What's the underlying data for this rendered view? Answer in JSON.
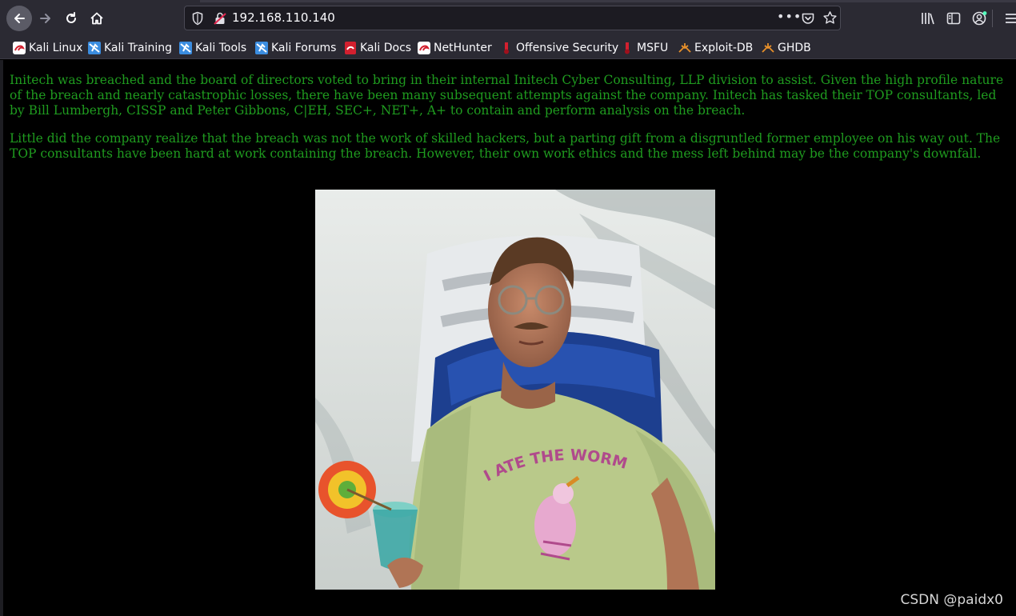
{
  "browser": {
    "url": "192.168.110.140"
  },
  "bookmarks": [
    {
      "label": "Kali Linux",
      "icon": "kali-dragon-icon"
    },
    {
      "label": "Kali Training",
      "icon": "kali-training-icon"
    },
    {
      "label": "Kali Tools",
      "icon": "kali-tools-icon"
    },
    {
      "label": "Kali Forums",
      "icon": "kali-forums-icon"
    },
    {
      "label": "Kali Docs",
      "icon": "kali-docs-icon"
    },
    {
      "label": "NetHunter",
      "icon": "nethunter-icon"
    },
    {
      "label": "Offensive Security",
      "icon": "offsec-icon"
    },
    {
      "label": "MSFU",
      "icon": "msfu-icon"
    },
    {
      "label": "Exploit-DB",
      "icon": "exploit-db-icon"
    },
    {
      "label": "GHDB",
      "icon": "ghdb-icon"
    }
  ],
  "page": {
    "paragraphs": [
      "Initech was breached and the board of directors voted to bring in their internal Initech Cyber Consulting, LLP division to assist. Given the high profile nature of the breach and nearly catastrophic losses, there have been many subsequent attempts against the company. Initech has tasked their TOP consultants, led by Bill Lumbergh, CISSP and Peter Gibbons, C|EH, SEC+, NET+, A+ to contain and perform analysis on the breach.",
      "Little did the company realize that the breach was not the work of skilled hackers, but a parting gift from a disgruntled former employee on his way out. The TOP consultants have been hard at work containing the breach. However, their own work ethics and the mess left behind may be the company's downfall."
    ],
    "image_shirt_text": "I ATE THE WORM!!"
  },
  "watermark": "CSDN @paidx0",
  "colors": {
    "page_text": "#1f9b1f",
    "background": "#000000",
    "chrome": "#2b2a33"
  }
}
